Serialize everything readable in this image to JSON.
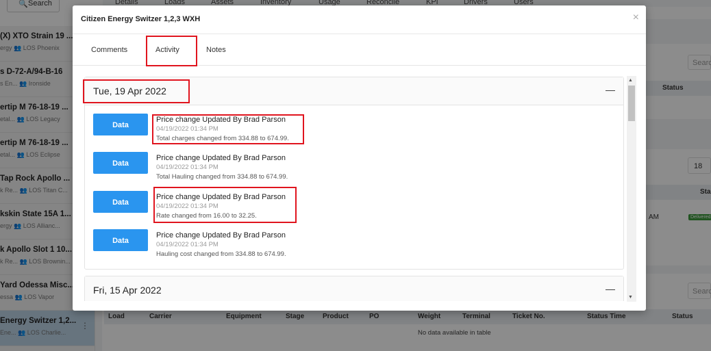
{
  "background": {
    "search_label": "Search",
    "top_tabs": [
      "Details",
      "Loads",
      "Assets",
      "Inventory",
      "Usage",
      "Reconcile",
      "KPI",
      "Drivers",
      "Users"
    ],
    "sidebar_items": [
      {
        "title": "(X) XTO Strain 19 ...",
        "sub": "ergy  👥 LOS Phoenix"
      },
      {
        "title": "s D-72-A/94-B-16",
        "sub": "s En...  👥 Ironside"
      },
      {
        "title": "ertip M 76-18-19 ...",
        "sub": "etal...  👥 LOS Legacy"
      },
      {
        "title": "ertip M 76-18-19 ...",
        "sub": "etal...  👥 LOS Eclipse"
      },
      {
        "title": "Tap Rock Apollo ...",
        "sub": "k Re...  👥 LOS Titan C..."
      },
      {
        "title": "kskin State 15A 1...",
        "sub": "ergy  👥 LOS Allianc..."
      },
      {
        "title": "k Apollo Slot 1 10...",
        "sub": "k Re...  👥 LOS Brownin..."
      },
      {
        "title": "Yard Odessa Misc...",
        "sub": "essa  👥 LOS Vapor"
      },
      {
        "title": "Energy Switzer 1,2...",
        "sub": "Ene...  👥 LOS Charlie..."
      }
    ],
    "table_headers": [
      "Load",
      "Carrier",
      "Equipment",
      "Stage",
      "Product",
      "PO",
      "Weight",
      "Terminal",
      "Ticket No.",
      "Status Time",
      "Status"
    ],
    "empty_table": "No data available in table",
    "status_col": "Status",
    "page_size": "18",
    "status_abbrev": "Sta",
    "am_text": "AM",
    "badge": "Delivered",
    "search_placeholder": "Searc"
  },
  "modal": {
    "title": "Citizen Energy Switzer 1,2,3 WXH",
    "close_icon": "×",
    "tabs": [
      "Comments",
      "Activity",
      "Notes"
    ],
    "active_tab": "Activity",
    "groups": [
      {
        "date": "Tue, 19 Apr 2022",
        "entries": [
          {
            "button": "Data",
            "title": "Price change Updated By Brad Parson",
            "time": "04/19/2022 01:34 PM",
            "desc": "Total charges changed from 334.88 to 674.99."
          },
          {
            "button": "Data",
            "title": "Price change Updated By Brad Parson",
            "time": "04/19/2022 01:34 PM",
            "desc": "Total Hauling changed from 334.88 to 674.99."
          },
          {
            "button": "Data",
            "title": "Price change Updated By Brad Parson",
            "time": "04/19/2022 01:34 PM",
            "desc": "Rate changed from 16.00 to 32.25."
          },
          {
            "button": "Data",
            "title": "Price change Updated By Brad Parson",
            "time": "04/19/2022 01:34 PM",
            "desc": "Hauling cost changed from 334.88 to 674.99."
          }
        ]
      },
      {
        "date": "Fri, 15 Apr 2022",
        "entries": []
      }
    ],
    "collapse_icon": "—"
  },
  "colors": {
    "primary_button": "#2a95ef",
    "highlight": "#e0141e",
    "active_sidebar": "#bcd3e6"
  }
}
